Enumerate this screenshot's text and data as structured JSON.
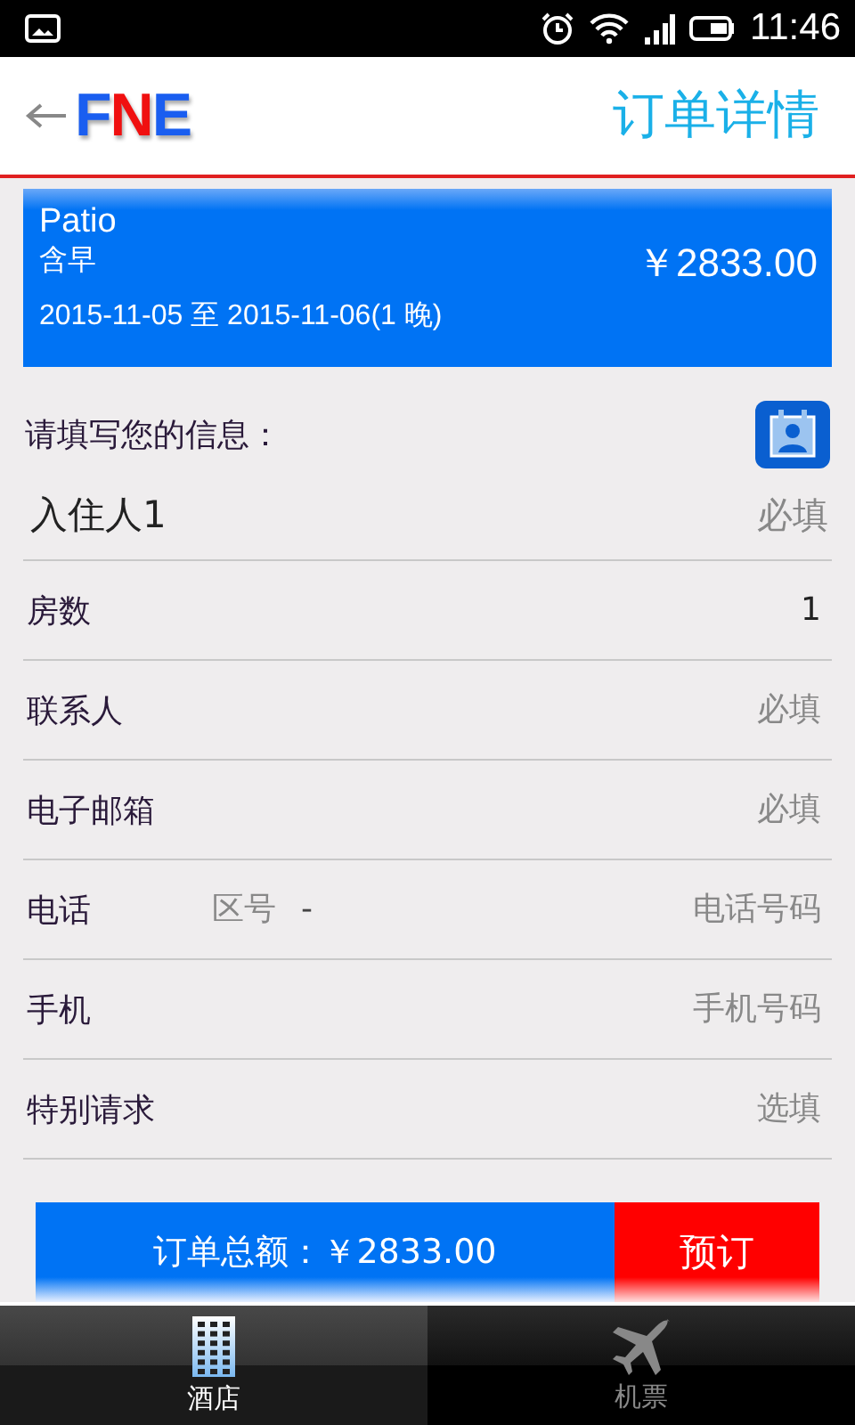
{
  "status_bar": {
    "time": "11:46"
  },
  "header": {
    "title": "订单详情",
    "logo": "FNE"
  },
  "room": {
    "name": "Patio",
    "meal": "含早",
    "price": "￥2833.00",
    "dates": "2015-11-05 至 2015-11-06(1 晚)"
  },
  "form": {
    "prompt": "请填写您的信息：",
    "fields": [
      {
        "kind": "text",
        "label": "入住人1",
        "placeholder": "必填"
      },
      {
        "kind": "value",
        "label": "房数",
        "value": "1"
      },
      {
        "kind": "text",
        "label": "联系人",
        "placeholder": "必填"
      },
      {
        "kind": "text",
        "label": "电子邮箱",
        "placeholder": "必填"
      },
      {
        "kind": "phone",
        "label": "电话",
        "area_placeholder": "区号",
        "separator": "-",
        "placeholder": "电话号码"
      },
      {
        "kind": "text",
        "label": "手机",
        "placeholder": "手机号码"
      },
      {
        "kind": "text",
        "label": "特别请求",
        "placeholder": "选填"
      }
    ]
  },
  "order_bar": {
    "total": "订单总额：￥2833.00",
    "button": "预订"
  },
  "tabs": [
    {
      "label": "酒店",
      "kind": "hotel",
      "selected": true
    },
    {
      "label": "机票",
      "kind": "flight",
      "selected": false
    }
  ]
}
